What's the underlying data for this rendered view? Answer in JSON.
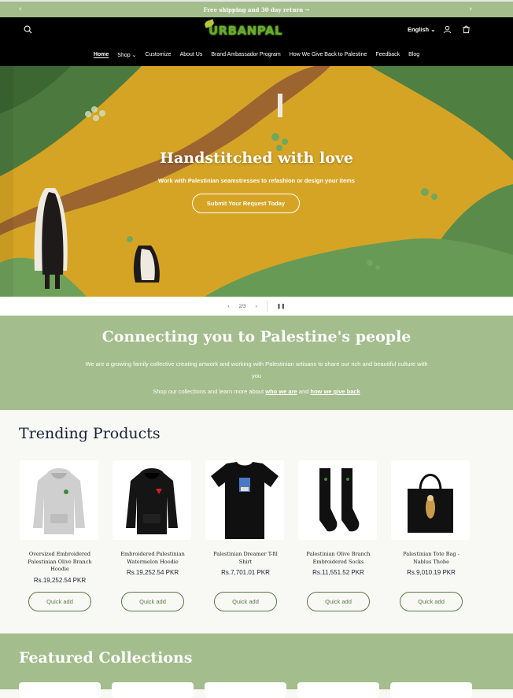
{
  "announcement": {
    "text": "Free shipping and 30 day return →"
  },
  "header": {
    "logo_text": "URBANPAL",
    "language": "English"
  },
  "nav": {
    "items": [
      "Home",
      "Shop",
      "Customize",
      "About Us",
      "Brand Ambassador Program",
      "How We Give Back to Palestine",
      "Feedback",
      "Blog"
    ]
  },
  "hero": {
    "title": "Handstitched with love",
    "subtitle": "Work with Palestinian seamstresses to refashion or design your items",
    "button": "Submit Your Request Today",
    "slide_counter": "2/3"
  },
  "mission": {
    "title": "Connecting you to Palestine's people",
    "paragraph": "We are a growing family collective creating artwork and working with Palestinian artisans to share our rich and beautiful culture with you",
    "shop_text": "Shop our collections and learn more about",
    "link1": "who we are",
    "and": "and",
    "link2": "how we give back"
  },
  "trending": {
    "title": "Trending Products",
    "products": [
      {
        "name": "Oversized Embroidered Palestinian Olive Branch Hoodie",
        "price": "Rs.19,252.54 PKR",
        "quick_add": "Quick add"
      },
      {
        "name": "Embroidered Palestinian Watermelon Hoodie",
        "price": "Rs.19,252.54 PKR",
        "quick_add": "Quick add"
      },
      {
        "name": "Palestinian Dreamer T-fil Shirt",
        "price": "Rs.7,701.01 PKR",
        "quick_add": "Quick add"
      },
      {
        "name": "Palestinian Olive Branch Embroidered Socks",
        "price": "Rs.11,551.52 PKR",
        "quick_add": "Quick add"
      },
      {
        "name": "Palestinian Tote Bag - Nablus Thobe",
        "price": "Rs.9,010.19 PKR",
        "quick_add": "Quick add"
      }
    ]
  },
  "featured": {
    "title": "Featured Collections"
  },
  "colors": {
    "sage": "#a3bd8c",
    "navy": "#1a2238",
    "button_green": "#5b7a4a",
    "header": "#000000"
  }
}
